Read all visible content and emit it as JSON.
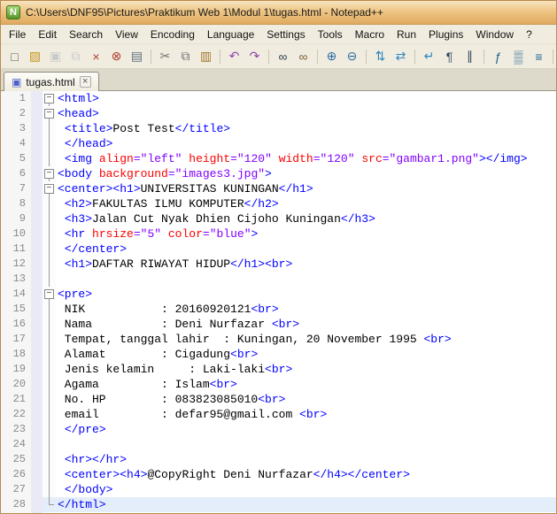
{
  "window": {
    "title": "C:\\Users\\DNF95\\Pictures\\Praktikum Web 1\\Modul 1\\tugas.html - Notepad++",
    "app_icon_glyph": "N"
  },
  "menu": {
    "items": [
      "File",
      "Edit",
      "Search",
      "View",
      "Encoding",
      "Language",
      "Settings",
      "Tools",
      "Macro",
      "Run",
      "Plugins",
      "Window",
      "?"
    ]
  },
  "toolbar": {
    "icons": [
      {
        "name": "new-file",
        "glyph": "□",
        "color": "#5a5a5a"
      },
      {
        "name": "open-file",
        "glyph": "▨",
        "color": "#c8951f"
      },
      {
        "name": "save-file",
        "glyph": "▣",
        "color": "#8a94a8",
        "disabled": true
      },
      {
        "name": "save-all",
        "glyph": "⧉",
        "color": "#8a94a8",
        "disabled": true
      },
      {
        "name": "close-file",
        "glyph": "×",
        "color": "#b03a2e"
      },
      {
        "name": "close-all",
        "glyph": "⊗",
        "color": "#b03a2e"
      },
      {
        "name": "print",
        "glyph": "▤",
        "color": "#5d6d7e"
      },
      {
        "sep": true
      },
      {
        "name": "cut",
        "glyph": "✂",
        "color": "#707070"
      },
      {
        "name": "copy",
        "glyph": "⧉",
        "color": "#707070"
      },
      {
        "name": "paste",
        "glyph": "▥",
        "color": "#a5762a"
      },
      {
        "sep": true
      },
      {
        "name": "undo",
        "glyph": "↶",
        "color": "#8e44ad"
      },
      {
        "name": "redo",
        "glyph": "↷",
        "color": "#8e44ad"
      },
      {
        "sep": true
      },
      {
        "name": "find",
        "glyph": "∞",
        "color": "#2c3e50"
      },
      {
        "name": "replace",
        "glyph": "∞",
        "color": "#7f5c2c"
      },
      {
        "sep": true
      },
      {
        "name": "zoom-in",
        "glyph": "⊕",
        "color": "#2e6da4"
      },
      {
        "name": "zoom-out",
        "glyph": "⊖",
        "color": "#2e6da4"
      },
      {
        "sep": true
      },
      {
        "name": "sync-vertical-scroll",
        "glyph": "⇅",
        "color": "#2e86c1"
      },
      {
        "name": "sync-horizontal-scroll",
        "glyph": "⇄",
        "color": "#2e86c1"
      },
      {
        "sep": true
      },
      {
        "name": "word-wrap",
        "glyph": "↵",
        "color": "#2e86c1"
      },
      {
        "name": "show-all-characters",
        "glyph": "¶",
        "color": "#34495e"
      },
      {
        "name": "indent-guide",
        "glyph": "∥",
        "color": "#34495e"
      },
      {
        "sep": true
      },
      {
        "name": "function-list",
        "glyph": "ƒ",
        "color": "#1f618d"
      },
      {
        "name": "document-map",
        "glyph": "▒",
        "color": "#1f618d"
      },
      {
        "name": "document-switcher",
        "glyph": "≡",
        "color": "#1f618d"
      },
      {
        "sep": true
      },
      {
        "name": "record-macro",
        "glyph": "●",
        "color": "#9aa0a6",
        "disabled": true
      },
      {
        "name": "stop-macro",
        "glyph": "■",
        "color": "#9aa0a6",
        "disabled": true
      },
      {
        "name": "play-macro",
        "glyph": "▶",
        "color": "#16727c",
        "disabled": true
      },
      {
        "name": "save-macro",
        "glyph": "◆",
        "color": "#c8951f",
        "disabled": true
      }
    ]
  },
  "tab": {
    "label": "tugas.html",
    "doc_icon": "▣",
    "close_glyph": "×"
  },
  "editor": {
    "fold_collapse_glyph": "−",
    "lines": [
      {
        "num": 1,
        "fold": "start",
        "seg": [
          {
            "c": "tag",
            "t": "<html>"
          }
        ]
      },
      {
        "num": 2,
        "fold": "start",
        "seg": [
          {
            "c": "tag",
            "t": "<head>"
          }
        ]
      },
      {
        "num": 3,
        "fold": "line",
        "seg": [
          {
            "c": "txt",
            "t": " "
          },
          {
            "c": "tag",
            "t": "<title>"
          },
          {
            "c": "txt",
            "t": "Post Test"
          },
          {
            "c": "tag",
            "t": "</title>"
          }
        ]
      },
      {
        "num": 4,
        "fold": "line",
        "seg": [
          {
            "c": "txt",
            "t": " "
          },
          {
            "c": "tag",
            "t": "</head>"
          }
        ]
      },
      {
        "num": 5,
        "fold": "line",
        "seg": [
          {
            "c": "txt",
            "t": " "
          },
          {
            "c": "tag",
            "t": "<img "
          },
          {
            "c": "attr",
            "t": "align"
          },
          {
            "c": "val",
            "t": "=\"left\""
          },
          {
            "c": "txt",
            "t": " "
          },
          {
            "c": "attr",
            "t": "height"
          },
          {
            "c": "val",
            "t": "=\"120\""
          },
          {
            "c": "txt",
            "t": " "
          },
          {
            "c": "attr",
            "t": "width"
          },
          {
            "c": "val",
            "t": "=\"120\""
          },
          {
            "c": "txt",
            "t": " "
          },
          {
            "c": "attr",
            "t": "src"
          },
          {
            "c": "val",
            "t": "=\"gambar1.png\""
          },
          {
            "c": "tag",
            "t": "></img>"
          }
        ]
      },
      {
        "num": 6,
        "fold": "start",
        "seg": [
          {
            "c": "tag",
            "t": "<body "
          },
          {
            "c": "attr",
            "t": "background"
          },
          {
            "c": "val",
            "t": "=\"images3.jpg\""
          },
          {
            "c": "tag",
            "t": ">"
          }
        ]
      },
      {
        "num": 7,
        "fold": "start",
        "seg": [
          {
            "c": "tag",
            "t": "<center><h1>"
          },
          {
            "c": "txt",
            "t": "UNIVERSITAS KUNINGAN"
          },
          {
            "c": "tag",
            "t": "</h1>"
          }
        ]
      },
      {
        "num": 8,
        "fold": "line",
        "seg": [
          {
            "c": "txt",
            "t": " "
          },
          {
            "c": "tag",
            "t": "<h2>"
          },
          {
            "c": "txt",
            "t": "FAKULTAS ILMU KOMPUTER"
          },
          {
            "c": "tag",
            "t": "</h2>"
          }
        ]
      },
      {
        "num": 9,
        "fold": "line",
        "seg": [
          {
            "c": "txt",
            "t": " "
          },
          {
            "c": "tag",
            "t": "<h3>"
          },
          {
            "c": "txt",
            "t": "Jalan Cut Nyak Dhien Cijoho Kuningan"
          },
          {
            "c": "tag",
            "t": "</h3>"
          }
        ]
      },
      {
        "num": 10,
        "fold": "line",
        "seg": [
          {
            "c": "txt",
            "t": " "
          },
          {
            "c": "tag",
            "t": "<hr "
          },
          {
            "c": "attr",
            "t": "hrsize"
          },
          {
            "c": "val",
            "t": "=\"5\""
          },
          {
            "c": "txt",
            "t": " "
          },
          {
            "c": "attr",
            "t": "color"
          },
          {
            "c": "val",
            "t": "=\"blue\""
          },
          {
            "c": "tag",
            "t": ">"
          }
        ]
      },
      {
        "num": 11,
        "fold": "line",
        "seg": [
          {
            "c": "txt",
            "t": " "
          },
          {
            "c": "tag",
            "t": "</center>"
          }
        ]
      },
      {
        "num": 12,
        "fold": "line",
        "seg": [
          {
            "c": "txt",
            "t": " "
          },
          {
            "c": "tag",
            "t": "<h1>"
          },
          {
            "c": "txt",
            "t": "DAFTAR RIWAYAT HIDUP"
          },
          {
            "c": "tag",
            "t": "</h1><br>"
          }
        ]
      },
      {
        "num": 13,
        "fold": "line",
        "seg": []
      },
      {
        "num": 14,
        "fold": "start",
        "seg": [
          {
            "c": "tag",
            "t": "<pre>"
          }
        ]
      },
      {
        "num": 15,
        "fold": "line",
        "seg": [
          {
            "c": "txt",
            "t": " NIK           : 20160920121"
          },
          {
            "c": "tag",
            "t": "<br>"
          }
        ]
      },
      {
        "num": 16,
        "fold": "line",
        "seg": [
          {
            "c": "txt",
            "t": " Nama          : Deni Nurfazar "
          },
          {
            "c": "tag",
            "t": "<br>"
          }
        ]
      },
      {
        "num": 17,
        "fold": "line",
        "seg": [
          {
            "c": "txt",
            "t": " Tempat, tanggal lahir  : Kuningan, 20 November 1995 "
          },
          {
            "c": "tag",
            "t": "<br>"
          }
        ]
      },
      {
        "num": 18,
        "fold": "line",
        "seg": [
          {
            "c": "txt",
            "t": " Alamat        : Cigadung"
          },
          {
            "c": "tag",
            "t": "<br>"
          }
        ]
      },
      {
        "num": 19,
        "fold": "line",
        "seg": [
          {
            "c": "txt",
            "t": " Jenis kelamin     : Laki-laki"
          },
          {
            "c": "tag",
            "t": "<br>"
          }
        ]
      },
      {
        "num": 20,
        "fold": "line",
        "seg": [
          {
            "c": "txt",
            "t": " Agama         : Islam"
          },
          {
            "c": "tag",
            "t": "<br>"
          }
        ]
      },
      {
        "num": 21,
        "fold": "line",
        "seg": [
          {
            "c": "txt",
            "t": " No. HP        : 083823085010"
          },
          {
            "c": "tag",
            "t": "<br>"
          }
        ]
      },
      {
        "num": 22,
        "fold": "line",
        "seg": [
          {
            "c": "txt",
            "t": " email         : defar95@gmail.com "
          },
          {
            "c": "tag",
            "t": "<br>"
          }
        ]
      },
      {
        "num": 23,
        "fold": "line",
        "seg": [
          {
            "c": "txt",
            "t": " "
          },
          {
            "c": "tag",
            "t": "</pre>"
          }
        ]
      },
      {
        "num": 24,
        "fold": "line",
        "seg": []
      },
      {
        "num": 25,
        "fold": "line",
        "seg": [
          {
            "c": "txt",
            "t": " "
          },
          {
            "c": "tag",
            "t": "<hr></hr>"
          }
        ]
      },
      {
        "num": 26,
        "fold": "line",
        "seg": [
          {
            "c": "txt",
            "t": " "
          },
          {
            "c": "tag",
            "t": "<center><h4>"
          },
          {
            "c": "txt",
            "t": "@CopyRight Deni Nurfazar"
          },
          {
            "c": "tag",
            "t": "</h4></center>"
          }
        ]
      },
      {
        "num": 27,
        "fold": "line",
        "seg": [
          {
            "c": "txt",
            "t": " "
          },
          {
            "c": "tag",
            "t": "</body>"
          }
        ]
      },
      {
        "num": 28,
        "fold": "end",
        "active": true,
        "seg": [
          {
            "c": "tag",
            "t": "</html>"
          }
        ]
      }
    ]
  },
  "colors": {
    "tag": "#0000ff",
    "attribute": "#ff0000",
    "attribute_value": "#8000ff",
    "text": "#000000",
    "current_line_highlight": "#e4eefa",
    "titlebar_accent": "#e0a95f"
  }
}
